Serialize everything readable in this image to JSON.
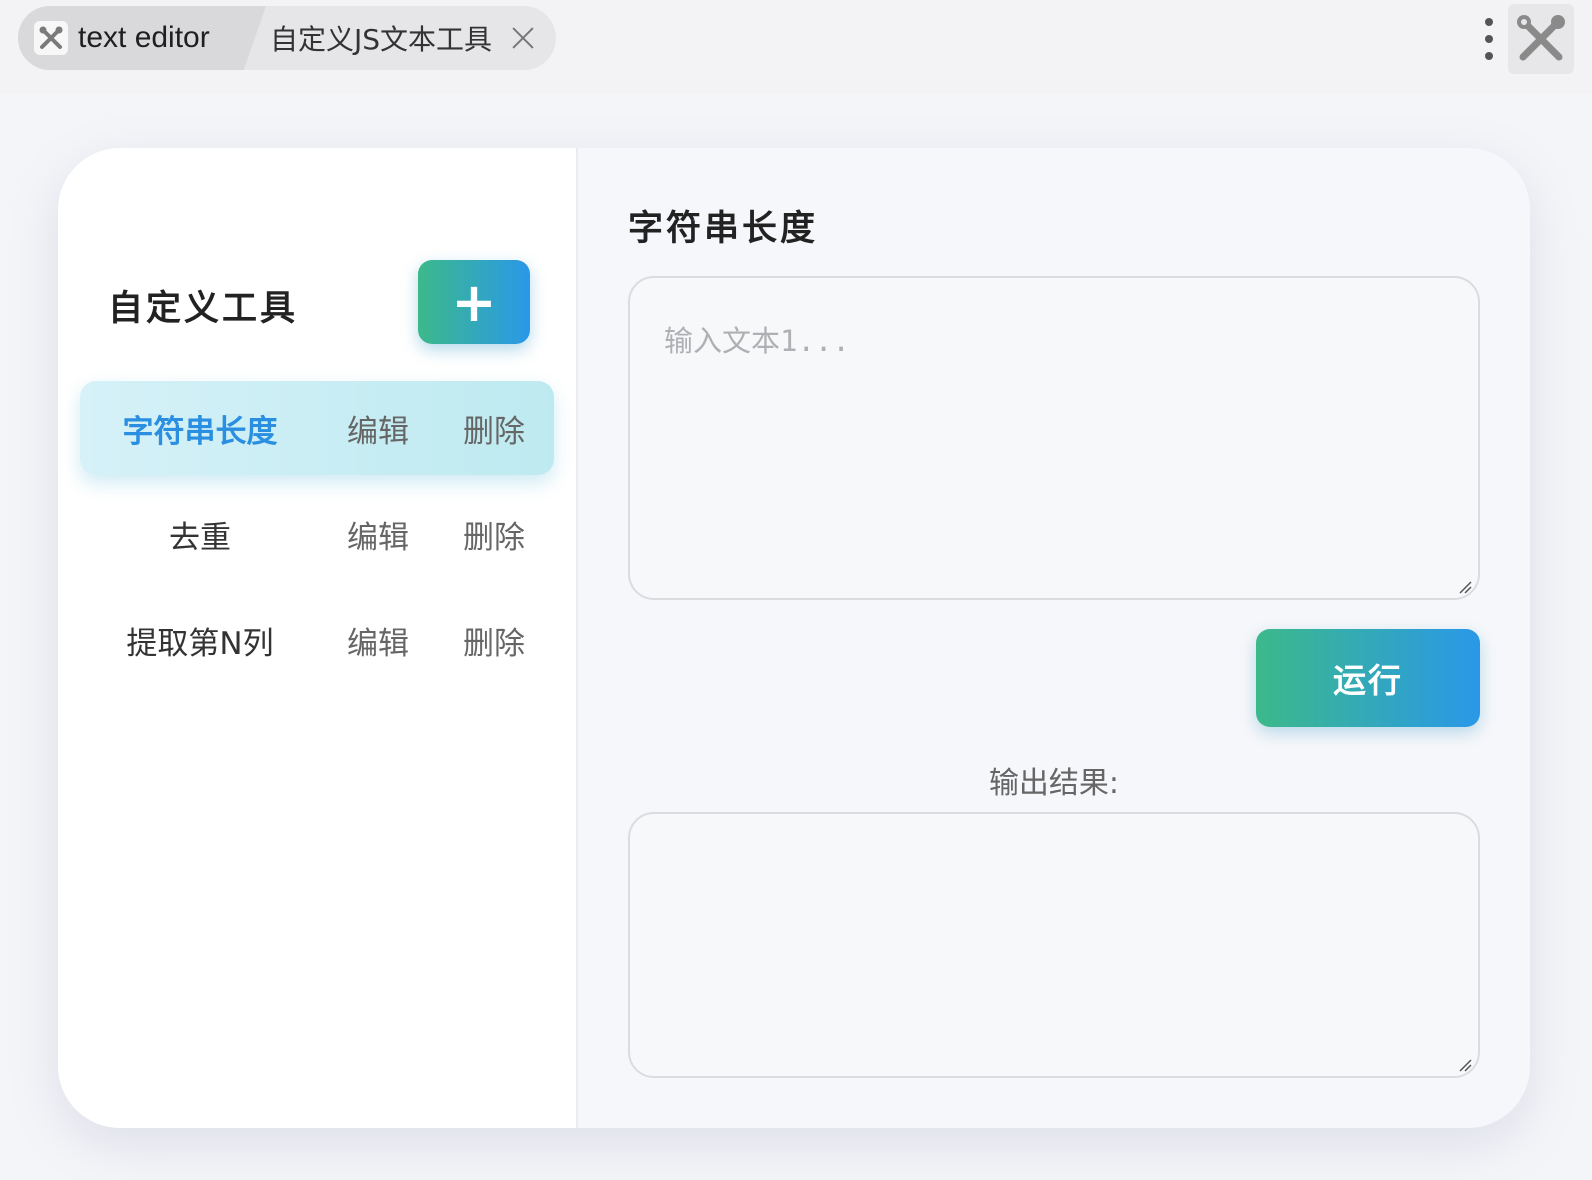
{
  "titlebar": {
    "app_tab_title": "text editor",
    "plugin_tab_label": "自定义JS文本工具"
  },
  "sidebar": {
    "title": "自定义工具",
    "add_label": "+",
    "items": [
      {
        "name": "字符串长度",
        "edit": "编辑",
        "delete": "删除",
        "active": true
      },
      {
        "name": "去重",
        "edit": "编辑",
        "delete": "删除",
        "active": false
      },
      {
        "name": "提取第N列",
        "edit": "编辑",
        "delete": "删除",
        "active": false
      }
    ]
  },
  "main": {
    "title": "字符串长度",
    "input_placeholder": "输入文本1...",
    "input_value": "",
    "run_label": "运行",
    "output_label": "输出结果:",
    "output_value": ""
  },
  "colors": {
    "accent_start": "#3cb98a",
    "accent_end": "#2a98e8",
    "active_text": "#2a8fe0"
  }
}
